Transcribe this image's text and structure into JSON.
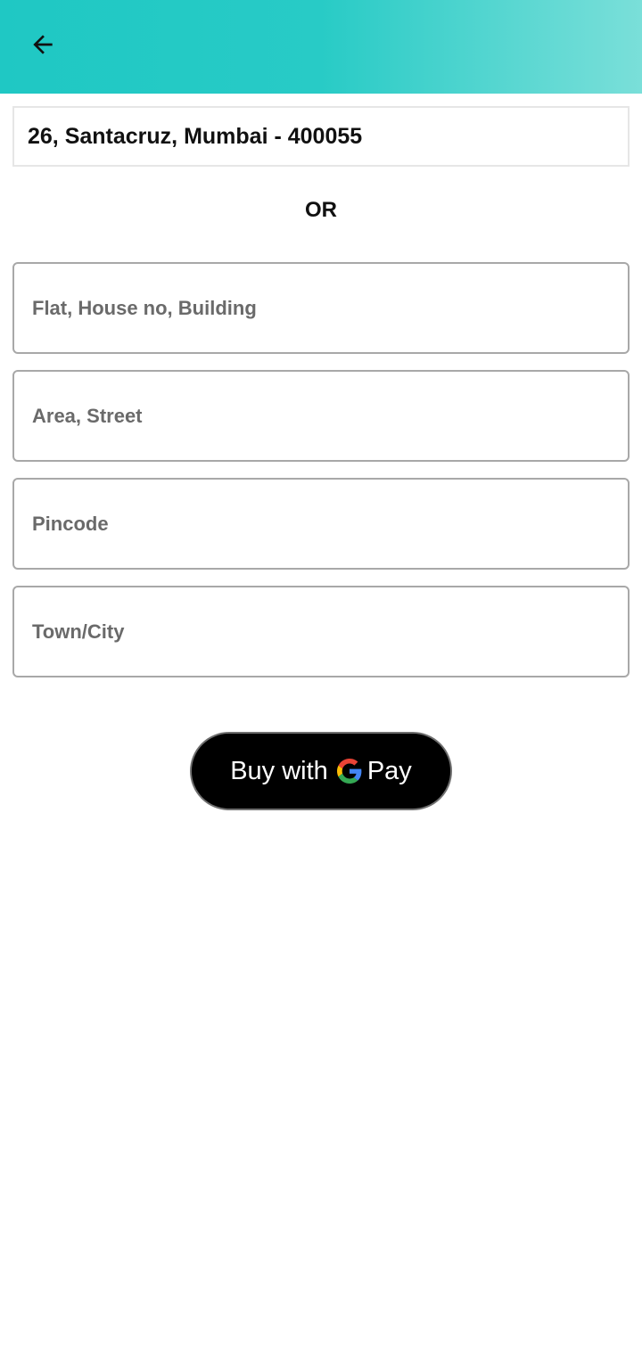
{
  "app_bar": {
    "back_icon": "arrow-left-icon",
    "gradient": [
      "#1fc8c4",
      "#7adfd9"
    ]
  },
  "saved_address": "26, Santacruz, Mumbai - 400055",
  "separator": "OR",
  "form": {
    "fields": [
      {
        "placeholder": "Flat, House no, Building",
        "value": ""
      },
      {
        "placeholder": "Area, Street",
        "value": ""
      },
      {
        "placeholder": "Pincode",
        "value": ""
      },
      {
        "placeholder": "Town/City",
        "value": ""
      }
    ]
  },
  "pay_button": {
    "buy_label": "Buy with",
    "brand_label": "Pay",
    "logo": "google-g-icon",
    "background": "#000000"
  }
}
